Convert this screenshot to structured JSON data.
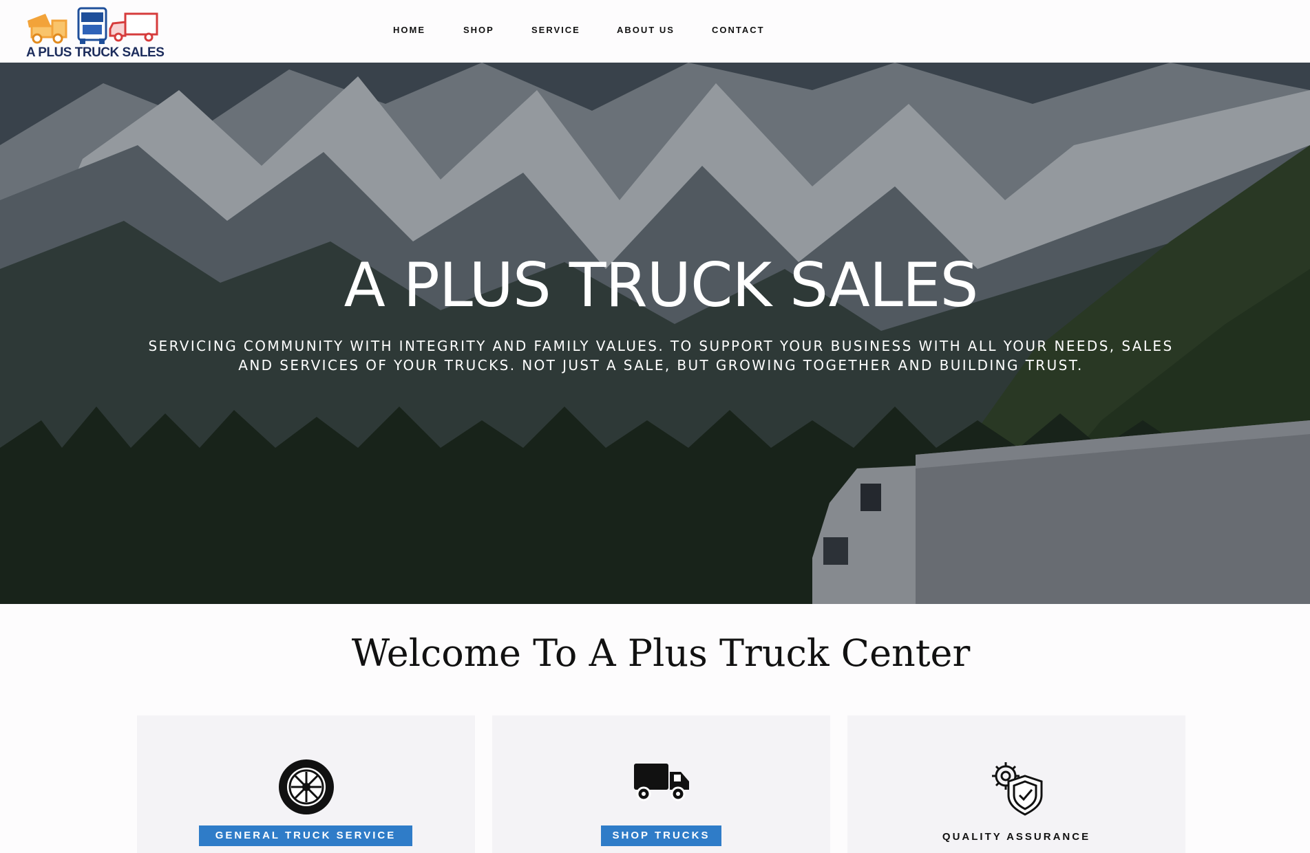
{
  "brand": {
    "logo_text": "A PLUS TRUCK SALES",
    "colors": {
      "orange": "#f2a33a",
      "blue": "#1f4f9a",
      "red": "#d63c3c",
      "navy": "#1c2c5c",
      "button_blue": "#2f7cc8"
    }
  },
  "nav": {
    "items": [
      {
        "label": "HOME"
      },
      {
        "label": "SHOP"
      },
      {
        "label": "SERVICE"
      },
      {
        "label": "ABOUT US"
      },
      {
        "label": "CONTACT"
      }
    ]
  },
  "hero": {
    "title": "A PLUS TRUCK SALES",
    "subtitle": "SERVICING COMMUNITY WITH INTEGRITY AND FAMILY VALUES. TO SUPPORT YOUR BUSINESS WITH ALL YOUR NEEDS, SALES AND SERVICES OF YOUR TRUCKS. NOT JUST A SALE, BUT GROWING TOGETHER AND BUILDING TRUST."
  },
  "welcome": {
    "heading": "Welcome To A Plus Truck Center"
  },
  "cards": [
    {
      "icon": "tire-icon",
      "label": "GENERAL TRUCK SERVICE"
    },
    {
      "icon": "truck-icon",
      "label": "SHOP TRUCKS"
    },
    {
      "icon": "gear-shield-icon",
      "label": "QUALITY ASSURANCE"
    }
  ]
}
